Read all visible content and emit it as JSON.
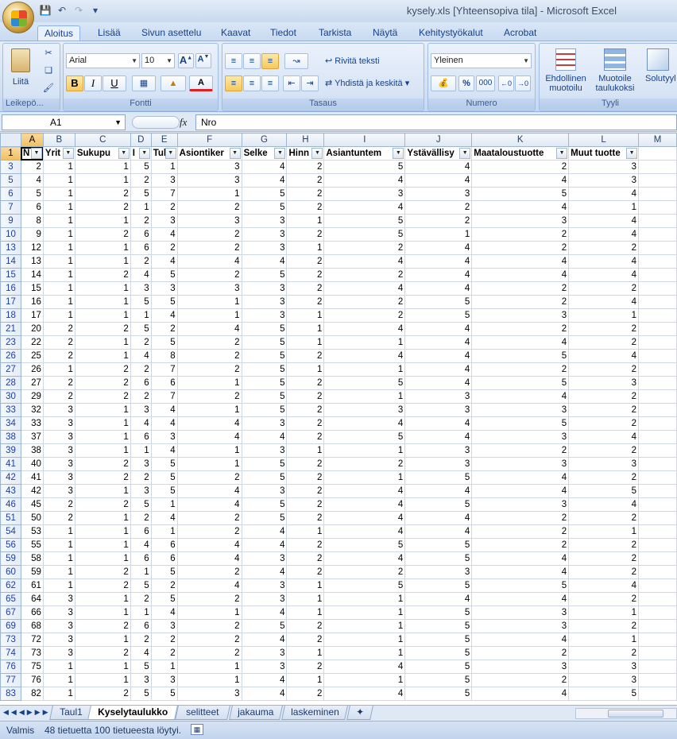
{
  "app": {
    "window_title": "kysely.xls  [Yhteensopiva tila] - Microsoft Excel",
    "qat_icons": [
      "save-icon",
      "undo-icon",
      "redo-icon",
      "customize-icon"
    ]
  },
  "tabs": [
    "Aloitus",
    "Lisää",
    "Sivun asettelu",
    "Kaavat",
    "Tiedot",
    "Tarkista",
    "Näytä",
    "Kehitystyökalut",
    "Acrobat"
  ],
  "ribbon": {
    "clipboard": {
      "label": "Leikepö...",
      "paste": "Liitä"
    },
    "font": {
      "label": "Fontti",
      "name": "Arial",
      "size": "10",
      "bold": "B",
      "italic": "I",
      "underline": "U",
      "grow": "A",
      "shrink": "A",
      "color_letter": "A"
    },
    "alignment": {
      "label": "Tasaus",
      "wrap": "Rivitä teksti",
      "merge": "Yhdistä ja keskitä"
    },
    "number": {
      "label": "Numero",
      "format": "Yleinen",
      "percent": "%",
      "thousands": "000"
    },
    "styles": {
      "label": "Tyyli",
      "conditional": "Ehdollinen\nmuotoilu",
      "conditional_1": "Ehdollinen",
      "conditional_2": "muotoilu",
      "table_1": "Muotoile",
      "table_2": "taulukoksi",
      "cell_1": "Solutyyl"
    }
  },
  "formula": {
    "namebox": "A1",
    "fx": "fx",
    "value": "Nro"
  },
  "columns": [
    "A",
    "B",
    "C",
    "D",
    "E",
    "F",
    "G",
    "H",
    "I",
    "J",
    "K",
    "L",
    "M"
  ],
  "header_row": {
    "row": "1",
    "cells": [
      "Nro",
      "Yritys",
      "Sukupuoli",
      "Ikä",
      "Tulot",
      "Asiontikerrat",
      "Selkeys",
      "Hinnat",
      "Asiantuntemus",
      "Ystävällisyys",
      "Maataloustuotteet",
      "Muut tuotteet"
    ]
  },
  "header_display": [
    "N",
    "Yrit",
    "Sukupu",
    "I",
    "Tul",
    "Asiontiker",
    "Selke",
    "Hinn",
    "Asiantuntem",
    "Ystävällisy",
    "Maataloustuotte",
    "Muut tuotte"
  ],
  "rows": [
    [
      "3",
      "2",
      "1",
      "1",
      "5",
      "1",
      "3",
      "4",
      "2",
      "5",
      "4",
      "2",
      "3"
    ],
    [
      "5",
      "4",
      "1",
      "1",
      "2",
      "3",
      "3",
      "4",
      "2",
      "4",
      "4",
      "4",
      "3"
    ],
    [
      "6",
      "5",
      "1",
      "2",
      "5",
      "7",
      "1",
      "5",
      "2",
      "3",
      "3",
      "5",
      "4"
    ],
    [
      "7",
      "6",
      "1",
      "2",
      "1",
      "2",
      "2",
      "5",
      "2",
      "4",
      "2",
      "4",
      "1"
    ],
    [
      "9",
      "8",
      "1",
      "1",
      "2",
      "3",
      "3",
      "3",
      "1",
      "5",
      "2",
      "3",
      "4"
    ],
    [
      "10",
      "9",
      "1",
      "2",
      "6",
      "4",
      "2",
      "3",
      "2",
      "5",
      "1",
      "2",
      "4"
    ],
    [
      "13",
      "12",
      "1",
      "1",
      "6",
      "2",
      "2",
      "3",
      "1",
      "2",
      "4",
      "2",
      "2"
    ],
    [
      "14",
      "13",
      "1",
      "1",
      "2",
      "4",
      "4",
      "4",
      "2",
      "4",
      "4",
      "4",
      "4"
    ],
    [
      "15",
      "14",
      "1",
      "2",
      "4",
      "5",
      "2",
      "5",
      "2",
      "2",
      "4",
      "4",
      "4"
    ],
    [
      "16",
      "15",
      "1",
      "1",
      "3",
      "3",
      "3",
      "3",
      "2",
      "4",
      "4",
      "2",
      "2"
    ],
    [
      "17",
      "16",
      "1",
      "1",
      "5",
      "5",
      "1",
      "3",
      "2",
      "2",
      "5",
      "2",
      "4"
    ],
    [
      "18",
      "17",
      "1",
      "1",
      "1",
      "4",
      "1",
      "3",
      "1",
      "2",
      "5",
      "3",
      "1"
    ],
    [
      "21",
      "20",
      "2",
      "2",
      "5",
      "2",
      "4",
      "5",
      "1",
      "4",
      "4",
      "2",
      "2"
    ],
    [
      "23",
      "22",
      "2",
      "1",
      "2",
      "5",
      "2",
      "5",
      "1",
      "1",
      "4",
      "4",
      "2"
    ],
    [
      "26",
      "25",
      "2",
      "1",
      "4",
      "8",
      "2",
      "5",
      "2",
      "4",
      "4",
      "5",
      "4"
    ],
    [
      "27",
      "26",
      "1",
      "2",
      "2",
      "7",
      "2",
      "5",
      "1",
      "1",
      "4",
      "2",
      "2"
    ],
    [
      "28",
      "27",
      "2",
      "2",
      "6",
      "6",
      "1",
      "5",
      "2",
      "5",
      "4",
      "5",
      "3"
    ],
    [
      "30",
      "29",
      "2",
      "2",
      "2",
      "7",
      "2",
      "5",
      "2",
      "1",
      "3",
      "4",
      "2"
    ],
    [
      "33",
      "32",
      "3",
      "1",
      "3",
      "4",
      "1",
      "5",
      "2",
      "3",
      "3",
      "3",
      "2"
    ],
    [
      "34",
      "33",
      "3",
      "1",
      "4",
      "4",
      "4",
      "3",
      "2",
      "4",
      "4",
      "5",
      "2"
    ],
    [
      "38",
      "37",
      "3",
      "1",
      "6",
      "3",
      "4",
      "4",
      "2",
      "5",
      "4",
      "3",
      "4"
    ],
    [
      "39",
      "38",
      "3",
      "1",
      "1",
      "4",
      "1",
      "3",
      "1",
      "1",
      "3",
      "2",
      "2"
    ],
    [
      "41",
      "40",
      "3",
      "2",
      "3",
      "5",
      "1",
      "5",
      "2",
      "2",
      "3",
      "3",
      "3"
    ],
    [
      "42",
      "41",
      "3",
      "2",
      "2",
      "5",
      "2",
      "5",
      "2",
      "1",
      "5",
      "4",
      "2"
    ],
    [
      "43",
      "42",
      "3",
      "1",
      "3",
      "5",
      "4",
      "3",
      "2",
      "4",
      "4",
      "4",
      "5"
    ],
    [
      "46",
      "45",
      "2",
      "2",
      "5",
      "1",
      "4",
      "5",
      "2",
      "4",
      "5",
      "3",
      "4"
    ],
    [
      "51",
      "50",
      "2",
      "1",
      "2",
      "4",
      "2",
      "5",
      "2",
      "4",
      "4",
      "2",
      "2"
    ],
    [
      "54",
      "53",
      "1",
      "1",
      "6",
      "1",
      "2",
      "4",
      "1",
      "4",
      "4",
      "2",
      "1"
    ],
    [
      "56",
      "55",
      "1",
      "1",
      "4",
      "6",
      "4",
      "4",
      "2",
      "5",
      "5",
      "2",
      "2"
    ],
    [
      "59",
      "58",
      "1",
      "1",
      "6",
      "6",
      "4",
      "3",
      "2",
      "4",
      "5",
      "4",
      "2"
    ],
    [
      "60",
      "59",
      "1",
      "2",
      "1",
      "5",
      "2",
      "4",
      "2",
      "2",
      "3",
      "4",
      "2"
    ],
    [
      "62",
      "61",
      "1",
      "2",
      "5",
      "2",
      "4",
      "3",
      "1",
      "5",
      "5",
      "5",
      "4"
    ],
    [
      "65",
      "64",
      "3",
      "1",
      "2",
      "5",
      "2",
      "3",
      "1",
      "1",
      "4",
      "4",
      "2"
    ],
    [
      "67",
      "66",
      "3",
      "1",
      "1",
      "4",
      "1",
      "4",
      "1",
      "1",
      "5",
      "3",
      "1"
    ],
    [
      "69",
      "68",
      "3",
      "2",
      "6",
      "3",
      "2",
      "5",
      "2",
      "1",
      "5",
      "3",
      "2"
    ],
    [
      "73",
      "72",
      "3",
      "1",
      "2",
      "2",
      "2",
      "4",
      "2",
      "1",
      "5",
      "4",
      "1"
    ],
    [
      "74",
      "73",
      "3",
      "2",
      "4",
      "2",
      "2",
      "3",
      "1",
      "1",
      "5",
      "2",
      "2"
    ],
    [
      "76",
      "75",
      "1",
      "1",
      "5",
      "1",
      "1",
      "3",
      "2",
      "4",
      "5",
      "3",
      "3"
    ],
    [
      "77",
      "76",
      "1",
      "1",
      "3",
      "3",
      "1",
      "4",
      "1",
      "1",
      "5",
      "2",
      "3"
    ],
    [
      "83",
      "82",
      "1",
      "2",
      "5",
      "5",
      "3",
      "4",
      "2",
      "4",
      "5",
      "4",
      "5"
    ]
  ],
  "sheets": [
    "Taul1",
    "Kyselytaulukko",
    "selitteet",
    "jakauma",
    "laskeminen"
  ],
  "active_sheet": "Kyselytaulukko",
  "status": {
    "ready": "Valmis",
    "filter_msg": "48 tietuetta 100 tietueesta löytyi."
  }
}
